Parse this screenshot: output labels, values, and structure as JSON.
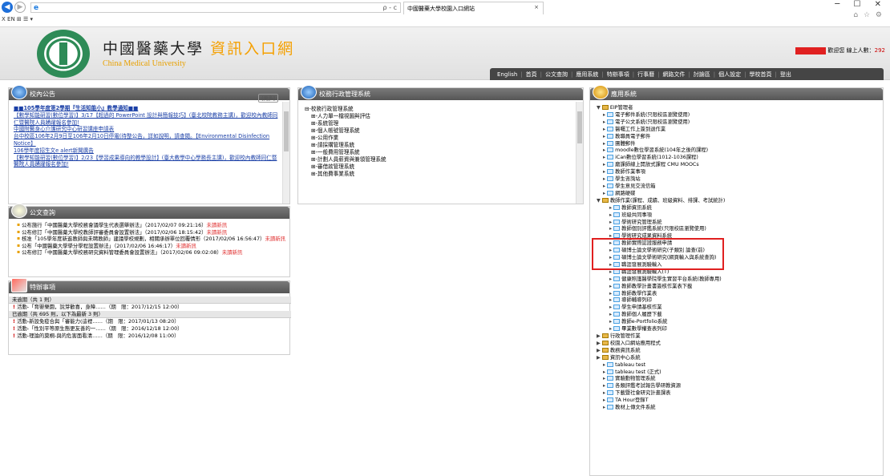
{
  "browser": {
    "url_icon": "ie-icon",
    "address_controls": "ρ - c",
    "tab_title": "中國醫藥大學校園入口網站",
    "window_controls": "─  ☐  ✕",
    "toolbar_icons": "⌂ ☆ ⚙",
    "command_bar": "X  EN  ⊞  ☰ ▾"
  },
  "header": {
    "univ_zh": "中國醫藥大學",
    "portal": "資訊入口網",
    "univ_en": "China Medical University",
    "welcome": "歡迎您 線上人數：",
    "online_count": "292"
  },
  "menu": [
    "English",
    "首頁",
    "公文查詢",
    "應用系統",
    "特辦事項",
    "行事曆",
    "網路文件",
    "討論區",
    "個人設定",
    "學校首頁",
    "登出"
  ],
  "news": {
    "title": "校內公告",
    "more": "[更多]",
    "items": [
      {
        "text": "■■105學年度第2學期『生活知能小』教學通知■■",
        "bold": true
      },
      {
        "text": "【數學知能研習(數位學習)】3/17【超過的 PowerPoint 設計與簡報技巧】(臺北校院教務主講)，歡迎校內教師同仁暨醫院人員踴躍報名參加!"
      },
      {
        "text": "中國附醫身心介護研究中心研習講座申請表"
      },
      {
        "text": "台中校區106年2月9日至106年2月10日停電(待整公告，詳如說明，請查閱。【Environmental Disinfection Notice】"
      },
      {
        "text": "106學年度招生文e alert新聞廣告"
      },
      {
        "text": "【數學知能研習(數位學習)】2/23【學習成果導向的教學設計】(臺大教學中心學務長主講)，歡迎校內教師同仁暨醫院人員踴躍報名參加!"
      }
    ]
  },
  "admin": {
    "title": "校務行政管理系統",
    "tree": [
      {
        "t": "⊟-校務行政管理系統",
        "l": 1
      },
      {
        "t": "⊞-人力單一檔視圖與評估",
        "l": 2
      },
      {
        "t": "⊞-系統管理",
        "l": 2
      },
      {
        "t": "⊞-個人帳號管理系統",
        "l": 2
      },
      {
        "t": "⊞-公用作業",
        "l": 2
      },
      {
        "t": "⊞-請採購管理系統",
        "l": 2
      },
      {
        "t": "⊞-一般費用管理系統",
        "l": 2
      },
      {
        "t": "⊞-計劃人員薪資與兼領管理系統",
        "l": 2
      },
      {
        "t": "⊞-審借款管理系統",
        "l": 2
      },
      {
        "t": "⊞-其他費事業系統",
        "l": 2
      }
    ]
  },
  "docs": {
    "title": "公文查詢",
    "items": [
      {
        "t": "公布施行「中國醫藥大學校務會議學生代表選舉辦法」（2017/02/07 09:21:16）",
        "n": "未讀新訊"
      },
      {
        "t": "公布修訂「中國醫藥大學校教師評審委員會設置辦法」（2017/02/06 18:15:42）",
        "n": "未讀新訊"
      },
      {
        "t": "核准「105學年度新進教師與未聘教師」建議學校規劃，相關承辦單位回覆情形（2017/02/06 16:56:47）",
        "n": "未讀新訊"
      },
      {
        "t": "公布「中國醫藥大學學分學程設置辦法」（2017/02/06 16:46:17）",
        "n": "未讀新訊"
      },
      {
        "t": "公布修訂「中國醫藥大學校務研究資料管理委員會設置辦法」（2017/02/06 09:02:08）",
        "n": "未讀新訊"
      }
    ]
  },
  "todo": {
    "title": "特辦事項",
    "groups": [
      {
        "label": "未逾期（共 1 則）",
        "hl": "",
        "items": [
          {
            "t": "活動-「育嬰樂園，說芽歡喜，身障……（期　限：2017/12/15 12:00）"
          }
        ]
      },
      {
        "label": "已逾期（共 695 則，以下為最新 3 則）",
        "hl": "695",
        "items": [
          {
            "t": "活動-新設免疫合與「審能力(這裡……（期　限：2017/01/13 08:20）"
          },
          {
            "t": "活動-「性別平等原生態更友善的一……（期　限：2016/12/18 12:00）"
          },
          {
            "t": "活動-理論的莫桐-與的危害面看清……（期　限：2016/12/08 11:00）"
          }
        ]
      }
    ]
  },
  "sys": {
    "title": "應用系統",
    "tree": [
      {
        "t": "EIP管理者",
        "l": 1,
        "f": "o"
      },
      {
        "t": "電子郵件系統(只限校區瀏覽使用)",
        "l": 2
      },
      {
        "t": "電子公文系統(只限校區瀏覽使用)",
        "l": 2
      },
      {
        "t": "醫囑工作上簽到退作業",
        "l": 2
      },
      {
        "t": "教職員電子郵件",
        "l": 2
      },
      {
        "t": "團體郵件",
        "l": 2
      },
      {
        "t": "moodle數位學習系統(104年之後的課程)",
        "l": 2
      },
      {
        "t": "iCan數位學習系統(1012-1036課程)",
        "l": 2
      },
      {
        "t": "磨課師線上開放式課程 CMU MOOCs",
        "l": 2
      },
      {
        "t": "教師作業事項",
        "l": 2
      },
      {
        "t": "學生咨詢站",
        "l": 2
      },
      {
        "t": "學生意見交流信箱",
        "l": 2
      },
      {
        "t": "網路硬碟",
        "l": 2
      },
      {
        "t": "教師作業(課程、成績、班級資料、排課、考試統計)",
        "l": 1,
        "f": "o"
      },
      {
        "t": "教師資訊系統",
        "l": 3
      },
      {
        "t": "班級共同事項",
        "l": 3
      },
      {
        "t": "學術研究管理系統",
        "l": 3
      },
      {
        "t": "教師個別評鑑系統(只限校區瀏覽使用)",
        "l": 3
      },
      {
        "t": "學術研究成果資料系統",
        "l": 3
      },
      {
        "t": "教師實際認證服務申請",
        "l": 3
      },
      {
        "t": "碩博士論文學術研究(子類別 論查(前)",
        "l": 3
      },
      {
        "t": "碩博士論文學術研究(網頁輸入與系統查詢)",
        "l": 3
      },
      {
        "t": "職涯發展測驗輸入",
        "l": 3
      },
      {
        "t": "職涯發展測驗輸入(T)",
        "l": 3
      },
      {
        "t": "健康照護醫學院學生實習平台系統(教師專用)",
        "l": 3
      },
      {
        "t": "教師教學計畫書簽核作業表下載",
        "l": 3
      },
      {
        "t": "教師教學作業表",
        "l": 3
      },
      {
        "t": "導師輔導列印",
        "l": 3
      },
      {
        "t": "學生申請基核作業",
        "l": 3
      },
      {
        "t": "教師個人履歷下載",
        "l": 3
      },
      {
        "t": "教師e-Portfolio系統",
        "l": 3
      },
      {
        "t": "畢業數學權查表列印",
        "l": 3
      },
      {
        "t": "行政管理作業",
        "l": 1,
        "f": "c"
      },
      {
        "t": "校園入口網站應用程式",
        "l": 1,
        "f": "c"
      },
      {
        "t": "教務資訊系統",
        "l": 1,
        "f": "c"
      },
      {
        "t": "資訊中心系統",
        "l": 1,
        "f": "c"
      },
      {
        "t": "tableau test",
        "l": 2
      },
      {
        "t": "tableau test (正式)",
        "l": 2
      },
      {
        "t": "實驗動物管理系統",
        "l": 2
      },
      {
        "t": "各類評鑑考試報告學研教資源",
        "l": 2
      },
      {
        "t": "下載暨社會研究計畫課表",
        "l": 2
      },
      {
        "t": "TA Hour登錄T",
        "l": 2
      },
      {
        "t": "教材上傳文件系統",
        "l": 2
      }
    ]
  },
  "colors": {
    "menu_bg": "#454545",
    "portal_orange": "#f5a000",
    "highlight_red": "#e02020",
    "new_red": "#e03030"
  }
}
